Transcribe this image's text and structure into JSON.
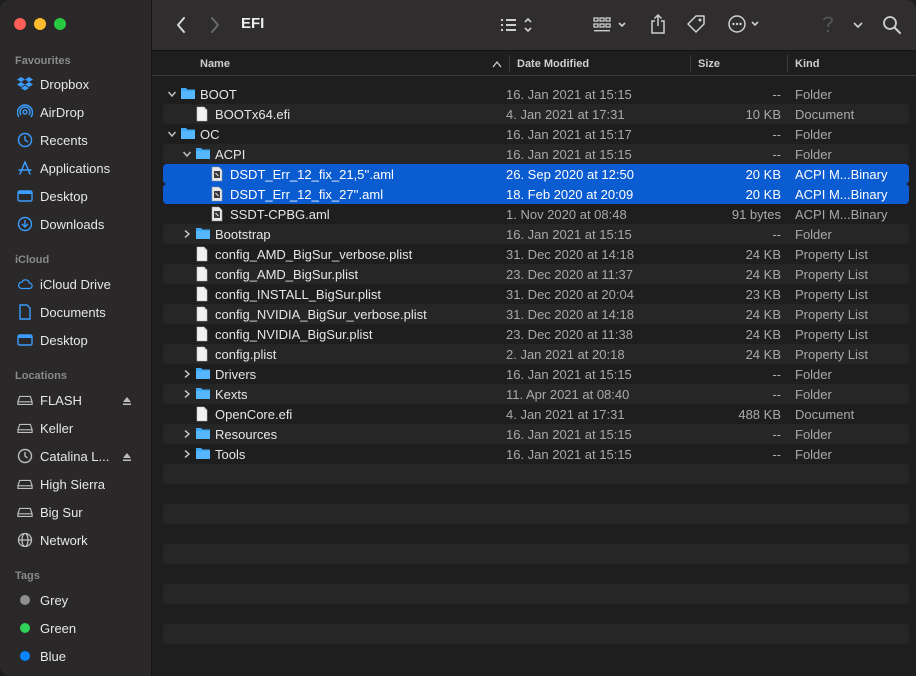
{
  "window": {
    "title": "EFI"
  },
  "sidebar": {
    "sections": [
      {
        "label": "Favourites"
      },
      {
        "label": "iCloud"
      },
      {
        "label": "Locations"
      },
      {
        "label": "Tags"
      }
    ],
    "favourites": [
      {
        "label": "Dropbox",
        "icon": "dropbox-icon"
      },
      {
        "label": "AirDrop",
        "icon": "airdrop-icon"
      },
      {
        "label": "Recents",
        "icon": "clock-icon"
      },
      {
        "label": "Applications",
        "icon": "applications-icon"
      },
      {
        "label": "Desktop",
        "icon": "desktop-icon"
      },
      {
        "label": "Downloads",
        "icon": "download-icon"
      }
    ],
    "icloud": [
      {
        "label": "iCloud Drive",
        "icon": "cloud-icon"
      },
      {
        "label": "Documents",
        "icon": "document-icon"
      },
      {
        "label": "Desktop",
        "icon": "desktop-icon"
      }
    ],
    "locations": [
      {
        "label": "FLASH",
        "icon": "drive-icon",
        "eject": true
      },
      {
        "label": "Keller",
        "icon": "drive-icon",
        "eject": false
      },
      {
        "label": "Catalina L...",
        "icon": "time-machine-icon",
        "eject": true
      },
      {
        "label": "High Sierra",
        "icon": "drive-icon",
        "eject": false
      },
      {
        "label": "Big Sur",
        "icon": "drive-icon",
        "eject": false
      },
      {
        "label": "Network",
        "icon": "network-icon",
        "eject": false
      }
    ],
    "tags": [
      {
        "label": "Grey",
        "color": "#8e8e93"
      },
      {
        "label": "Green",
        "color": "#30d158"
      },
      {
        "label": "Blue",
        "color": "#0a84ff"
      }
    ]
  },
  "columns": {
    "name": "Name",
    "date": "Date Modified",
    "size": "Size",
    "kind": "Kind"
  },
  "rows": [
    {
      "name": "BOOT",
      "date": "16. Jan 2021 at 15:15",
      "size": "--",
      "kind": "Folder",
      "type": "folder",
      "level": 0,
      "disclosure": "open",
      "selected": false
    },
    {
      "name": "BOOTx64.efi",
      "date": "4. Jan 2021 at 17:31",
      "size": "10 KB",
      "kind": "Document",
      "type": "doc",
      "level": 1,
      "disclosure": "none",
      "selected": false
    },
    {
      "name": "OC",
      "date": "16. Jan 2021 at 15:17",
      "size": "--",
      "kind": "Folder",
      "type": "folder",
      "level": 0,
      "disclosure": "open",
      "selected": false
    },
    {
      "name": "ACPI",
      "date": "16. Jan 2021 at 15:15",
      "size": "--",
      "kind": "Folder",
      "type": "folder",
      "level": 1,
      "disclosure": "open",
      "selected": false
    },
    {
      "name": "DSDT_Err_12_fix_21,5''.aml",
      "date": "26. Sep 2020 at 12:50",
      "size": "20 KB",
      "kind": "ACPI M...Binary",
      "type": "aml",
      "level": 2,
      "disclosure": "none",
      "selected": true
    },
    {
      "name": "DSDT_Err_12_fix_27''.aml",
      "date": "18. Feb 2020 at 20:09",
      "size": "20 KB",
      "kind": "ACPI M...Binary",
      "type": "aml",
      "level": 2,
      "disclosure": "none",
      "selected": true
    },
    {
      "name": "SSDT-CPBG.aml",
      "date": "1. Nov 2020 at 08:48",
      "size": "91 bytes",
      "kind": "ACPI M...Binary",
      "type": "aml",
      "level": 2,
      "disclosure": "none",
      "selected": false
    },
    {
      "name": "Bootstrap",
      "date": "16. Jan 2021 at 15:15",
      "size": "--",
      "kind": "Folder",
      "type": "folder",
      "level": 1,
      "disclosure": "closed",
      "selected": false
    },
    {
      "name": "config_AMD_BigSur_verbose.plist",
      "date": "31. Dec 2020 at 14:18",
      "size": "24 KB",
      "kind": "Property List",
      "type": "doc",
      "level": 1,
      "disclosure": "none",
      "selected": false
    },
    {
      "name": "config_AMD_BigSur.plist",
      "date": "23. Dec 2020 at 11:37",
      "size": "24 KB",
      "kind": "Property List",
      "type": "doc",
      "level": 1,
      "disclosure": "none",
      "selected": false
    },
    {
      "name": "config_INSTALL_BigSur.plist",
      "date": "31. Dec 2020 at 20:04",
      "size": "23 KB",
      "kind": "Property List",
      "type": "doc",
      "level": 1,
      "disclosure": "none",
      "selected": false
    },
    {
      "name": "config_NVIDIA_BigSur_verbose.plist",
      "date": "31. Dec 2020 at 14:18",
      "size": "24 KB",
      "kind": "Property List",
      "type": "doc",
      "level": 1,
      "disclosure": "none",
      "selected": false
    },
    {
      "name": "config_NVIDIA_BigSur.plist",
      "date": "23. Dec 2020 at 11:38",
      "size": "24 KB",
      "kind": "Property List",
      "type": "doc",
      "level": 1,
      "disclosure": "none",
      "selected": false
    },
    {
      "name": "config.plist",
      "date": "2. Jan 2021 at 20:18",
      "size": "24 KB",
      "kind": "Property List",
      "type": "doc",
      "level": 1,
      "disclosure": "none",
      "selected": false
    },
    {
      "name": "Drivers",
      "date": "16. Jan 2021 at 15:15",
      "size": "--",
      "kind": "Folder",
      "type": "folder",
      "level": 1,
      "disclosure": "closed",
      "selected": false
    },
    {
      "name": "Kexts",
      "date": "11. Apr 2021 at 08:40",
      "size": "--",
      "kind": "Folder",
      "type": "folder",
      "level": 1,
      "disclosure": "closed",
      "selected": false
    },
    {
      "name": "OpenCore.efi",
      "date": "4. Jan 2021 at 17:31",
      "size": "488 KB",
      "kind": "Document",
      "type": "doc",
      "level": 1,
      "disclosure": "none",
      "selected": false
    },
    {
      "name": "Resources",
      "date": "16. Jan 2021 at 15:15",
      "size": "--",
      "kind": "Folder",
      "type": "folder",
      "level": 1,
      "disclosure": "closed",
      "selected": false
    },
    {
      "name": "Tools",
      "date": "16. Jan 2021 at 15:15",
      "size": "--",
      "kind": "Folder",
      "type": "folder",
      "level": 1,
      "disclosure": "closed",
      "selected": false
    }
  ],
  "colors": {
    "selection": "#0b5cd1",
    "folder": "#3fa9f5",
    "accent": "#0a84ff"
  }
}
